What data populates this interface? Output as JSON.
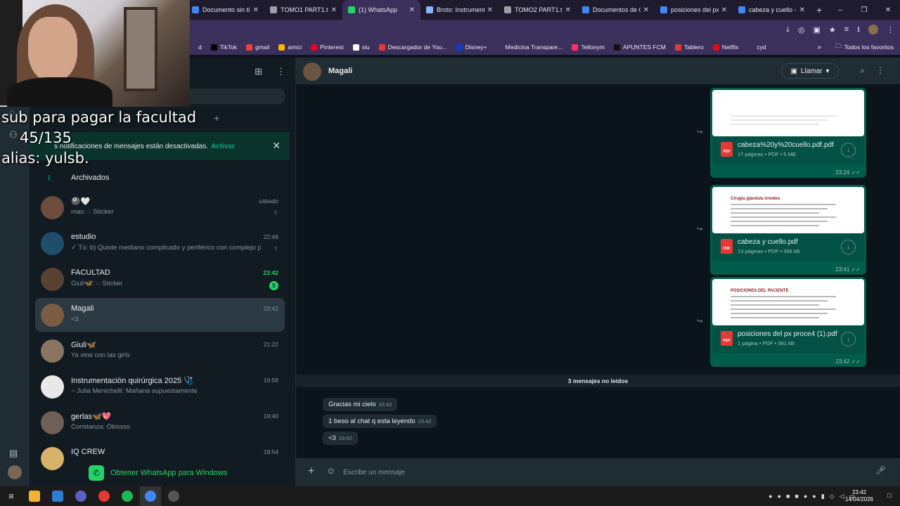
{
  "browser": {
    "tabs": [
      {
        "label": "Documento sin tí",
        "icon_color": "#4285f4",
        "active": false
      },
      {
        "label": "TOMO1 PART1.tif",
        "icon_color": "#9aa0a6",
        "active": false
      },
      {
        "label": "(1) WhatsApp",
        "icon_color": "#25d366",
        "active": true
      },
      {
        "label": "Broto: Instrument",
        "icon_color": "#8ab4f8",
        "active": false
      },
      {
        "label": "TOMO2 PART1.tif",
        "icon_color": "#9aa0a6",
        "active": false
      },
      {
        "label": "Documentos de G",
        "icon_color": "#4285f4",
        "active": false
      },
      {
        "label": "posiciones del px",
        "icon_color": "#4285f4",
        "active": false
      },
      {
        "label": "cabeza y cuello -",
        "icon_color": "#4285f4",
        "active": false
      }
    ],
    "new_tab": "+",
    "bookmarks": [
      {
        "label": "d",
        "color": "#3b2f5c"
      },
      {
        "label": "TikTok",
        "color": "#000000"
      },
      {
        "label": "gmail",
        "color": "#ea4335"
      },
      {
        "label": "amici",
        "color": "#f4b400"
      },
      {
        "label": "Pinterest",
        "color": "#e60023"
      },
      {
        "label": "siu",
        "color": "#ffffff"
      },
      {
        "label": "Descargador de You...",
        "color": "#e53935"
      },
      {
        "label": "Disney+",
        "color": "#113ccf"
      },
      {
        "label": "Medicina Transpare...",
        "color": "#3b2f5c"
      },
      {
        "label": "Tellonym",
        "color": "#ff3366"
      },
      {
        "label": "APUNTES FCM",
        "color": "#111111"
      },
      {
        "label": "Tablero",
        "color": "#e53935"
      },
      {
        "label": "Netflix",
        "color": "#e50914"
      },
      {
        "label": "cyd",
        "color": "#3b2f5c"
      }
    ],
    "bookmarks_more": "»",
    "all_bookmarks": "Todos los favoritos"
  },
  "overlay": {
    "line1": "sub para pagar la facultad",
    "line2": "45/135",
    "line3": "alias: yulsb."
  },
  "sidebar": {
    "notification_text": "s notificaciones de mensajes están desactivadas.",
    "notification_link": "Activar",
    "archived_label": "Archivados",
    "chats": [
      {
        "name": "🎱🤍",
        "message": "max: ◌ Sticker",
        "time": "sábado",
        "pinned": true,
        "unread": "",
        "avatar_color": "#6d4c3d",
        "active": false
      },
      {
        "name": "estudio",
        "message": "✓ Tú: b) Quiste mediano complicado y periférico con complejo p...",
        "time": "22:48",
        "pinned": true,
        "unread": "",
        "avatar_color": "#1f4e6a",
        "active": false
      },
      {
        "name": "FACULTAD",
        "message": "Giuli🦋: ◌ Sticker",
        "time": "23:42",
        "pinned": false,
        "unread": "5",
        "avatar_color": "#5a4032",
        "active": false
      },
      {
        "name": "Magali",
        "message": "<3",
        "time": "23:42",
        "pinned": false,
        "unread": "",
        "avatar_color": "#7a5c44",
        "active": true
      },
      {
        "name": "Giuli🦋",
        "message": "Ya vine con las girls",
        "time": "21:22",
        "pinned": false,
        "unread": "",
        "avatar_color": "#8a7560",
        "active": false
      },
      {
        "name": "Instrumentación quirúrgica 2025 🩺",
        "message": "~ Julia Menichelli: Mañana supuestamente",
        "time": "19:56",
        "pinned": false,
        "unread": "",
        "avatar_color": "#e8e8e8",
        "active": false
      },
      {
        "name": "gerlas🦋💖",
        "message": "Constanza: Okissss",
        "time": "19:40",
        "pinned": false,
        "unread": "",
        "avatar_color": "#6f5f55",
        "active": false
      },
      {
        "name": "IQ CREW",
        "message": "",
        "time": "18:54",
        "pinned": false,
        "unread": "",
        "avatar_color": "#d9b26a",
        "active": false
      }
    ],
    "get_whatsapp": "Obtener WhatsApp para Windows"
  },
  "conversation": {
    "contact_name": "Magali",
    "call_label": "Llamar",
    "documents": [
      {
        "name": "cabeza%20y%20cuello.pdf.pdf",
        "meta": "17 páginas • PDF • 5 MB",
        "time": "23:24",
        "preview_title": ""
      },
      {
        "name": "cabeza y cuello.pdf",
        "meta": "13 páginas • PDF • 356 kB",
        "time": "23:41",
        "preview_title": "Cirugía glándula tiroides"
      },
      {
        "name": "posiciones del px proce4 (1).pdf",
        "meta": "1 página • PDF • 391 kB",
        "time": "23:42",
        "preview_title": "POSICIONES DEL PACIENTE"
      }
    ],
    "unread_label": "3 mensajes no leídos",
    "messages": [
      {
        "text": "Gracias mi cielo",
        "time": "23:42"
      },
      {
        "text": "1 beso al chat q esta leyendo",
        "time": "23:42"
      },
      {
        "text": "<3",
        "time": "23:42"
      }
    ],
    "composer_placeholder": "Escribe un mensaje"
  },
  "taskbar": {
    "time": "23:42",
    "date": "14/04/2026"
  }
}
